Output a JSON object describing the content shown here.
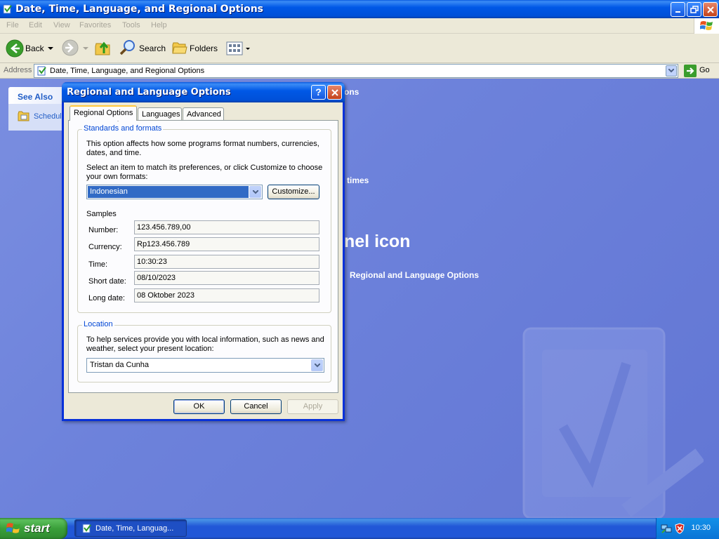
{
  "window": {
    "title": "Date, Time, Language, and Regional Options",
    "menu": [
      "File",
      "Edit",
      "View",
      "Favorites",
      "Tools",
      "Help"
    ],
    "toolbar": {
      "back": "Back",
      "search": "Search",
      "folders": "Folders"
    },
    "address": {
      "label": "Address",
      "value": "Date, Time, Language, and Regional Options",
      "go": "Go"
    }
  },
  "sidebar": {
    "title": "See Also",
    "link": "Schedule"
  },
  "background_text": {
    "t1": "ons",
    "t2": "times",
    "t3": "nel icon",
    "t4": "Regional and Language Options"
  },
  "dialog": {
    "title": "Regional and Language Options",
    "help_glyph": "?",
    "tabs": [
      "Regional Options",
      "Languages",
      "Advanced"
    ],
    "standards": {
      "label": "Standards and formats",
      "desc": "This option affects how some programs format numbers, currencies, dates, and time.",
      "instruction": "Select an item to match its preferences, or click Customize to choose your own formats:",
      "selected": "Indonesian",
      "customize": "Customize..."
    },
    "samples": {
      "label": "Samples",
      "rows": [
        {
          "label": "Number:",
          "value": "123.456.789,00"
        },
        {
          "label": "Currency:",
          "value": "Rp123.456.789"
        },
        {
          "label": "Time:",
          "value": "10:30:23"
        },
        {
          "label": "Short date:",
          "value": "08/10/2023"
        },
        {
          "label": "Long date:",
          "value": "08 Oktober 2023"
        }
      ]
    },
    "location": {
      "label": "Location",
      "desc": "To help services provide you with local information, such as news and weather, select your present location:",
      "selected": "Tristan da Cunha"
    },
    "buttons": {
      "ok": "OK",
      "cancel": "Cancel",
      "apply": "Apply"
    }
  },
  "taskbar": {
    "start": "start",
    "task": "Date, Time, Languag...",
    "clock": "10:30"
  }
}
